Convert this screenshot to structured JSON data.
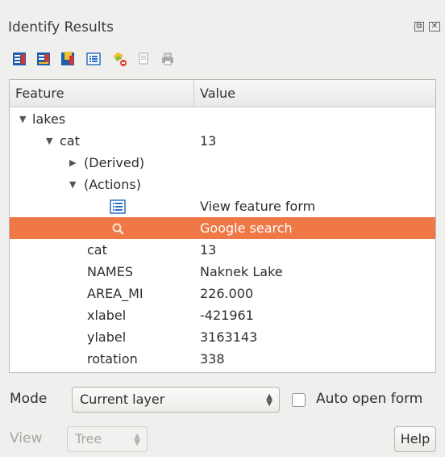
{
  "panel": {
    "title": "Identify Results",
    "float_icon": "float-icon",
    "close_icon": "close-icon"
  },
  "toolbar": [
    {
      "icon": "expand-all-icon"
    },
    {
      "icon": "collapse-all-icon"
    },
    {
      "icon": "expand-new-results-icon"
    },
    {
      "icon": "open-form-icon"
    },
    {
      "icon": "clear-results-icon"
    },
    {
      "icon": "copy-icon"
    },
    {
      "icon": "print-icon"
    }
  ],
  "tree": {
    "headers": {
      "feature": "Feature",
      "value": "Value"
    },
    "rows": [
      {
        "feature": "lakes",
        "value": "",
        "arrow": "▼"
      },
      {
        "feature": "cat",
        "value": "13",
        "arrow": "▼"
      },
      {
        "feature": "(Derived)",
        "value": "",
        "arrow": "▶"
      },
      {
        "feature": "(Actions)",
        "value": "",
        "arrow": "▼"
      },
      {
        "feature": "",
        "value": "View feature form",
        "icon": "form-icon"
      },
      {
        "feature": "",
        "value": "Google search",
        "icon": "search-action-icon",
        "selected": true
      },
      {
        "feature": "cat",
        "value": "13"
      },
      {
        "feature": "NAMES",
        "value": "Naknek Lake"
      },
      {
        "feature": "AREA_MI",
        "value": "226.000"
      },
      {
        "feature": "xlabel",
        "value": "-421961"
      },
      {
        "feature": "ylabel",
        "value": "3163143"
      },
      {
        "feature": "rotation",
        "value": "338"
      }
    ]
  },
  "controls": {
    "mode_label": "Mode",
    "mode_value": "Current layer",
    "auto_open_label": "Auto open form",
    "auto_open_checked": false,
    "view_label": "View",
    "view_value": "Tree",
    "help_label": "Help"
  },
  "colors": {
    "selection": "#f07746",
    "background": "#efefed"
  }
}
